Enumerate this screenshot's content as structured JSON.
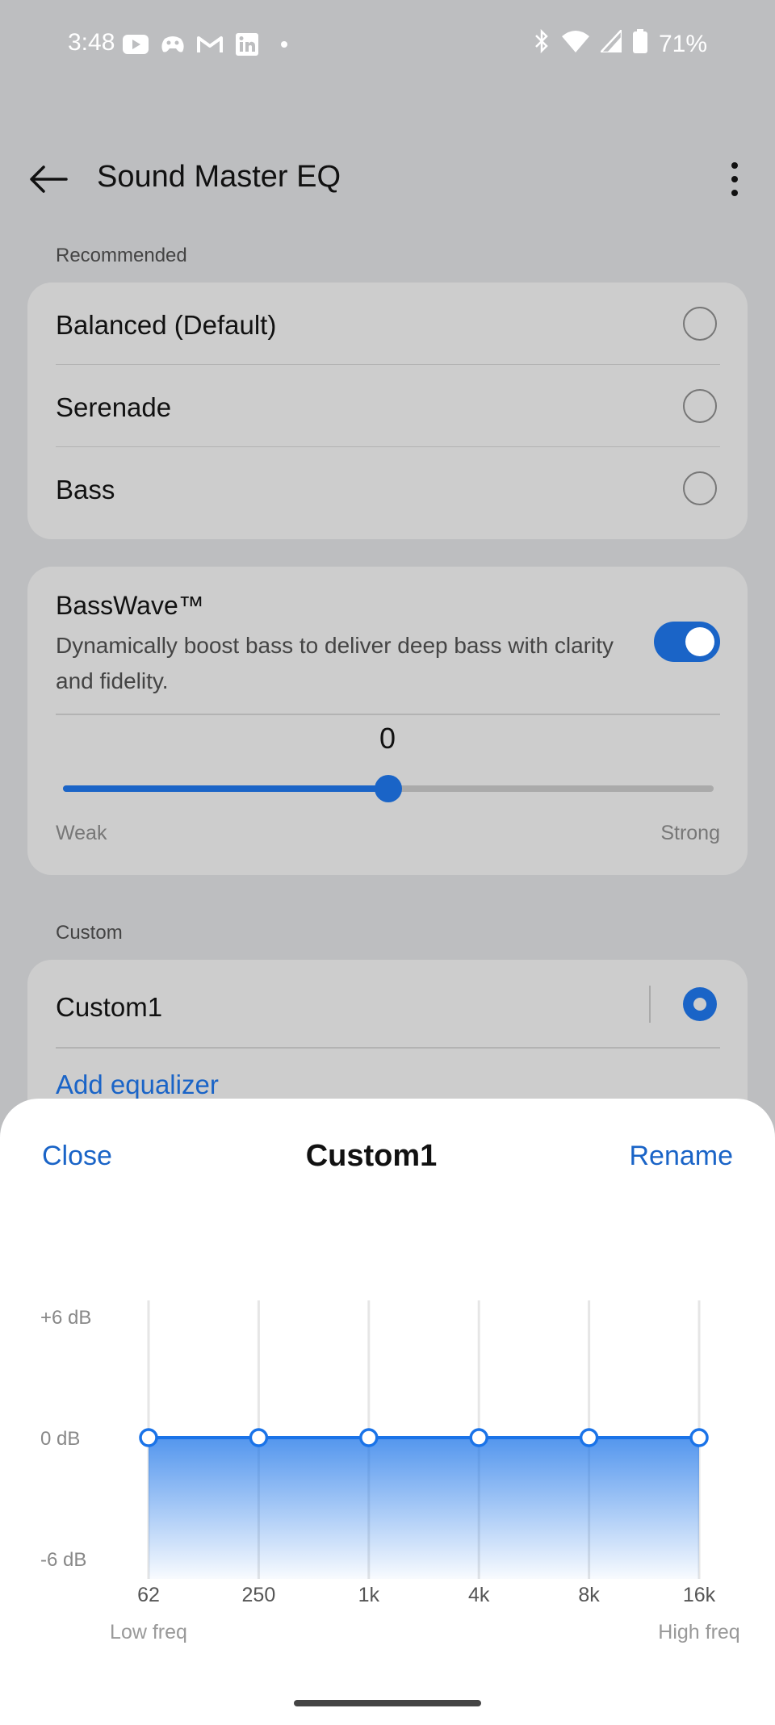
{
  "status_bar": {
    "time": "3:48",
    "left_icons": [
      "youtube-icon",
      "game-controller-icon",
      "gmail-icon",
      "linkedin-icon"
    ],
    "battery": "71%",
    "right_icons": [
      "bluetooth-icon",
      "wifi-icon",
      "cellular-icon",
      "battery-icon"
    ]
  },
  "appbar": {
    "title": "Sound Master EQ"
  },
  "recommended": {
    "label": "Recommended",
    "items": [
      {
        "label": "Balanced (Default)",
        "selected": false
      },
      {
        "label": "Serenade",
        "selected": false
      },
      {
        "label": "Bass",
        "selected": false
      }
    ]
  },
  "basswave": {
    "title": "BassWave™",
    "description": "Dynamically boost bass to deliver deep bass with clarity and fidelity.",
    "enabled": true,
    "value": "0",
    "slider_fraction": 0.5,
    "min_label": "Weak",
    "max_label": "Strong"
  },
  "custom": {
    "label": "Custom",
    "items": [
      {
        "label": "Custom1",
        "selected": true
      }
    ],
    "add_label": "Add equalizer"
  },
  "sheet": {
    "close_label": "Close",
    "title": "Custom1",
    "rename_label": "Rename"
  },
  "chart_data": {
    "type": "line",
    "categories": [
      "62",
      "250",
      "1k",
      "4k",
      "8k",
      "16k"
    ],
    "series": [
      {
        "values": [
          0,
          0,
          0,
          0,
          0,
          0
        ]
      }
    ],
    "y_tick_labels": [
      "+6 dB",
      "0 dB",
      "-6 dB"
    ],
    "ylim": [
      -6,
      6
    ],
    "x_low_label": "Low freq",
    "x_high_label": "High freq",
    "line_color": "#1a73e8",
    "grid": true
  },
  "colors": {
    "accent": "#1a64c7"
  }
}
